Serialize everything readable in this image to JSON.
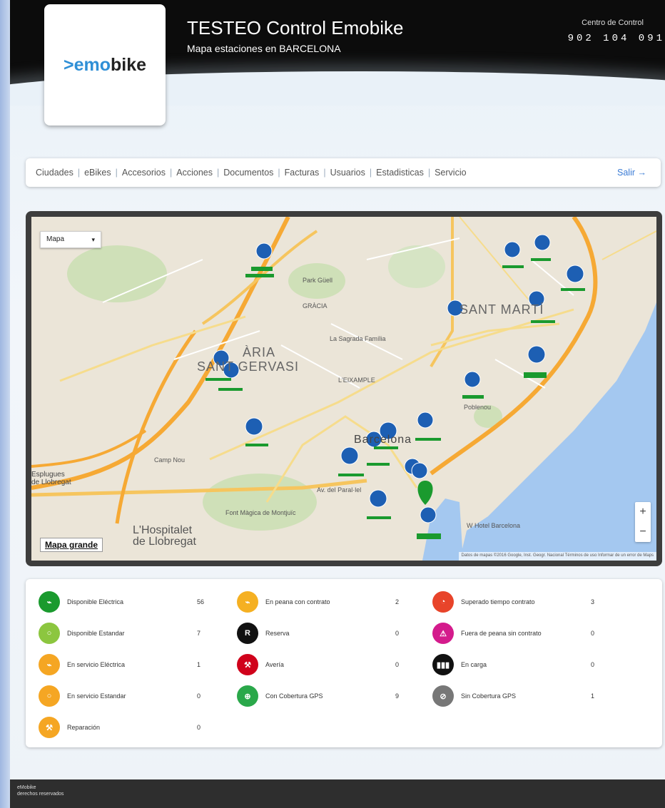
{
  "header": {
    "logo_prefix": ">e",
    "logo_accent": "mo",
    "logo_suffix": "bike",
    "title": "TESTEO Control Emobike",
    "subtitle": "Mapa estaciones en BARCELONA",
    "control_label": "Centro de Control",
    "control_phone": "902 104 091"
  },
  "nav": {
    "items": [
      "Ciudades",
      "eBikes",
      "Accesorios",
      "Acciones",
      "Documentos",
      "Facturas",
      "Usuarios",
      "Estadisticas",
      "Servicio"
    ],
    "logout": "Salir →"
  },
  "map": {
    "type_label": "Mapa",
    "big_map_label": "Mapa grande",
    "zoom_in": "+",
    "zoom_out": "−",
    "attribution": "Datos de mapas ©2016 Google, Inst. Geogr. Nacional   Términos de uso   Informar de un error de Maps",
    "labels": {
      "barcelona": "Barcelona",
      "sant_marti": "SANT MARTÍ",
      "gervasi_1": "ÀRIA",
      "gervasi_2": "SANT GERVASI",
      "hospitalet_1": "L'Hospitalet",
      "hospitalet_2": "de Llobregat",
      "esplugues_1": "Esplugues",
      "esplugues_2": "de Llobregat",
      "gracia": "GRÀCIA",
      "sagrada": "La Sagrada Família",
      "camp_nou": "Camp Nou",
      "park_guell": "Park Güell",
      "font_magica": "Font Màgica de Montjuïc",
      "hotel": "W Hotel Barcelona",
      "poblenou": "Poblenou",
      "eixample": "L'EIXAMPLE",
      "paralel": "Av. del Paral·lel"
    }
  },
  "legend": {
    "items": [
      {
        "label": "Disponible Eléctrica",
        "count": "56",
        "color": "#1a9a2e",
        "icon": "bike-electric-icon",
        "glyph": "⌁"
      },
      {
        "label": "Disponible Estandar",
        "count": "7",
        "color": "#8cc63f",
        "icon": "bike-standard-icon",
        "glyph": "○"
      },
      {
        "label": "En servicio Eléctrica",
        "count": "1",
        "color": "#f5a623",
        "icon": "bike-electric-service-icon",
        "glyph": "⌁"
      },
      {
        "label": "En servicio Estandar",
        "count": "0",
        "color": "#f5a623",
        "icon": "bike-standard-service-icon",
        "glyph": "○"
      },
      {
        "label": "Reparación",
        "count": "0",
        "color": "#f5a623",
        "icon": "wrench-icon",
        "glyph": "⚒"
      },
      {
        "label": "En peana con contrato",
        "count": "2",
        "color": "#f5b022",
        "icon": "dock-contract-icon",
        "glyph": "⌁"
      },
      {
        "label": "Reserva",
        "count": "0",
        "color": "#111111",
        "icon": "reserve-icon",
        "glyph": "R"
      },
      {
        "label": "Avería",
        "count": "0",
        "color": "#d0021b",
        "icon": "breakdown-icon",
        "glyph": "⚒"
      },
      {
        "label": "Con Cobertura GPS",
        "count": "9",
        "color": "#2aa84a",
        "icon": "gps-on-icon",
        "glyph": "⊕"
      },
      {
        "label": "Superado tiempo contrato",
        "count": "3",
        "color": "#e8442a",
        "icon": "timeout-icon",
        "glyph": "◔"
      },
      {
        "label": "Fuera de peana sin contrato",
        "count": "0",
        "color": "#d41b8c",
        "icon": "warning-icon",
        "glyph": "⚠"
      },
      {
        "label": "En carga",
        "count": "0",
        "color": "#111111",
        "icon": "battery-charging-icon",
        "glyph": "▮▮▮"
      },
      {
        "label": "Sin Cobertura GPS",
        "count": "1",
        "color": "#777777",
        "icon": "gps-off-icon",
        "glyph": "⊘"
      }
    ]
  },
  "footer": {
    "line1": "eMobike",
    "line2": "derechos reservados"
  }
}
